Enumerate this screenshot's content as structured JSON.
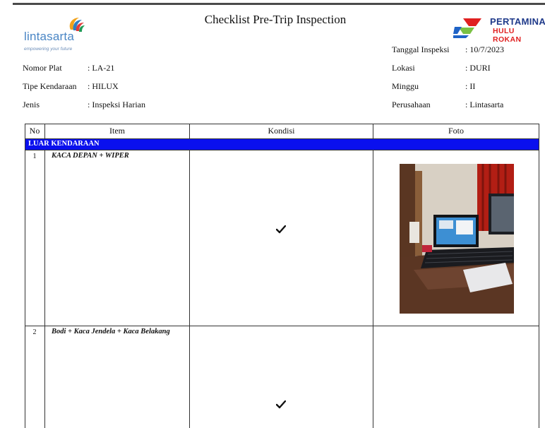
{
  "header": {
    "title": "Checklist Pre-Trip Inspection",
    "left_logo": {
      "name": "lintasarta",
      "tagline": "empowering your future"
    },
    "right_logo": {
      "name": "PERTAMINA",
      "sub": "HULU ROKAN"
    }
  },
  "info_left": [
    {
      "label": "Nomor Plat",
      "value": ": LA-21"
    },
    {
      "label": "Tipe Kendaraan",
      "value": ": HILUX"
    },
    {
      "label": "Jenis",
      "value": ": Inspeksi Harian"
    }
  ],
  "info_right": [
    {
      "label": "Tanggal Inspeksi",
      "value": ": 10/7/2023"
    },
    {
      "label": "Lokasi",
      "value": ": DURI"
    },
    {
      "label": "Minggu",
      "value": ": II"
    },
    {
      "label": "Perusahaan",
      "value": ": Lintasarta"
    }
  ],
  "table": {
    "columns": [
      "No",
      "Item",
      "Kondisi",
      "Foto"
    ],
    "section": "LUAR KENDARAAN",
    "rows": [
      {
        "no": "1",
        "item": "KACA DEPAN + WIPER",
        "kondisi": "check",
        "has_photo": true
      },
      {
        "no": "2",
        "item": "Bodi + Kaca Jendela + Kaca Belakang",
        "kondisi": "check",
        "has_photo": false
      }
    ]
  },
  "colors": {
    "section_bar": "#0a10ee",
    "lintasarta_blue": "#4a86c5",
    "pertamina_blue": "#1f3a8a",
    "pertamina_red": "#e02020"
  },
  "icons": {
    "check": "checkmark-icon"
  }
}
